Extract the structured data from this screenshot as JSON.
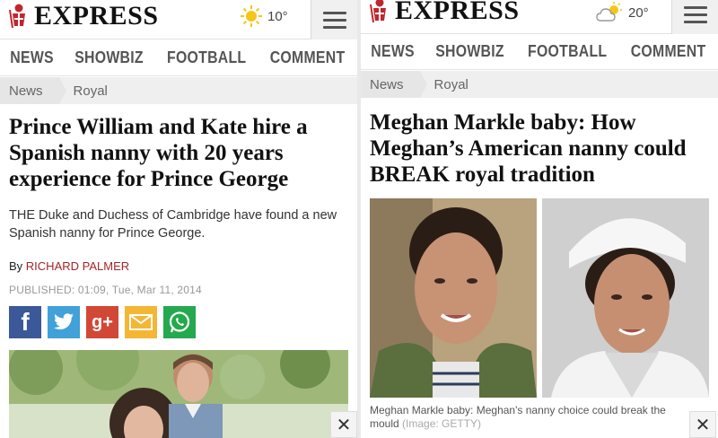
{
  "colors": {
    "accent_red": "#a5252a",
    "facebook": "#3b5998",
    "twitter": "#41a1d8",
    "googleplus": "#d14836",
    "email": "#f3b635",
    "whatsapp": "#25a94e"
  },
  "left": {
    "logo": "EXPRESS",
    "weather": {
      "icon": "sun-icon",
      "temp": "10°"
    },
    "nav": [
      "NEWS",
      "SHOWBIZ",
      "FOOTBALL",
      "COMMENT"
    ],
    "breadcrumb": [
      "News",
      "Royal"
    ],
    "headline": "Prince William and Kate hire a Spanish nanny with 20 years experience for Prince George",
    "standfirst": "THE Duke and Duchess of Cambridge have found a new Spanish nanny for Prince George.",
    "byline_prefix": "By",
    "author": "RICHARD PALMER",
    "published": "PUBLISHED: 01:09, Tue, Mar 11, 2014",
    "share_icons": [
      "facebook-icon",
      "twitter-icon",
      "googleplus-icon",
      "email-icon",
      "whatsapp-icon"
    ],
    "share_glyphs": {
      "facebook": "f",
      "googleplus": "g+"
    }
  },
  "right": {
    "logo": "EXPRESS",
    "weather": {
      "icon": "cloud-sun-icon",
      "temp": "20°"
    },
    "nav": [
      "NEWS",
      "SHOWBIZ",
      "FOOTBALL",
      "COMMENT"
    ],
    "breadcrumb": [
      "News",
      "Royal"
    ],
    "headline": "Meghan Markle baby: How Meghan’s American nanny could BREAK royal tradition",
    "caption": "Meghan Markle baby: Meghan's nanny choice could break the mould",
    "credit": "(Image: GETTY)"
  },
  "close_glyph": "✕"
}
